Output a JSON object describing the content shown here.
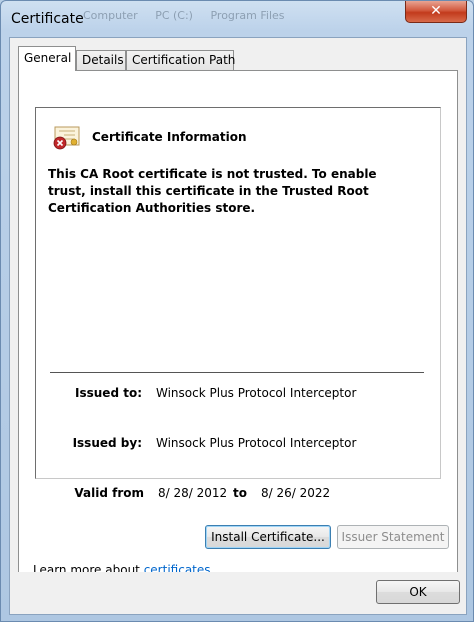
{
  "window": {
    "title": "Certificate",
    "close_glyph": "✕",
    "background_tabs": [
      "Computer",
      "PC (C:)",
      "Program Files"
    ]
  },
  "tabs": [
    {
      "label": "General",
      "active": true
    },
    {
      "label": "Details",
      "active": false
    },
    {
      "label": "Certification Path",
      "active": false
    }
  ],
  "info": {
    "icon": "certificate-error-icon",
    "heading": "Certificate Information",
    "message": "This CA Root certificate is not trusted. To enable trust, install this certificate in the Trusted Root Certification Authorities store.",
    "issued_to_label": "Issued to:",
    "issued_to_value": "Winsock Plus Protocol Interceptor",
    "issued_by_label": "Issued by:",
    "issued_by_value": "Winsock Plus Protocol Interceptor",
    "valid_from_label": "Valid from",
    "valid_from_value": "8/ 28/ 2012",
    "valid_to_label": "to",
    "valid_to_value": "8/ 26/ 2022"
  },
  "buttons": {
    "install": "Install Certificate...",
    "issuer_statement": "Issuer Statement",
    "ok": "OK"
  },
  "learn_more": {
    "prefix": "Learn more about ",
    "link": "certificates"
  },
  "colors": {
    "link": "#0066cc",
    "close_button": "#c23a1c",
    "error_badge": "#c0282a"
  }
}
